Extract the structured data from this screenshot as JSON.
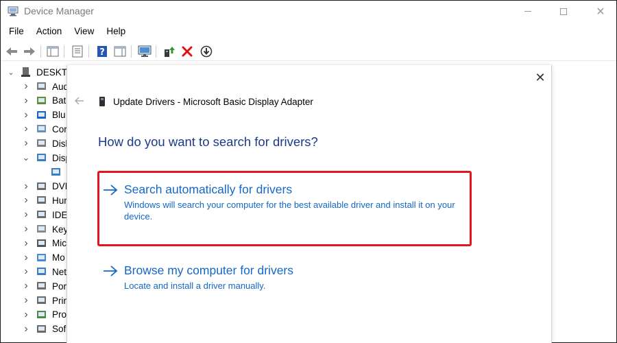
{
  "window": {
    "title": "Device Manager"
  },
  "menubar": [
    "File",
    "Action",
    "View",
    "Help"
  ],
  "tree": {
    "root_label": "DESKTO",
    "items": [
      {
        "label": "Aud",
        "expanded": false
      },
      {
        "label": "Bat",
        "expanded": false
      },
      {
        "label": "Blu",
        "expanded": false
      },
      {
        "label": "Cor",
        "expanded": false
      },
      {
        "label": "Disl",
        "expanded": false
      },
      {
        "label": "Disp",
        "expanded": true
      },
      {
        "label": "",
        "child": true
      },
      {
        "label": "DVD",
        "expanded": false
      },
      {
        "label": "Hur",
        "expanded": false
      },
      {
        "label": "IDE",
        "expanded": false
      },
      {
        "label": "Key",
        "expanded": false
      },
      {
        "label": "Mic",
        "expanded": false
      },
      {
        "label": "Mo",
        "expanded": false
      },
      {
        "label": "Net",
        "expanded": false
      },
      {
        "label": "Por",
        "expanded": false
      },
      {
        "label": "Prir",
        "expanded": false
      },
      {
        "label": "Pro",
        "expanded": false
      },
      {
        "label": "Sof",
        "expanded": false
      }
    ]
  },
  "dialog": {
    "title": "Update Drivers - Microsoft Basic Display Adapter",
    "heading": "How do you want to search for drivers?",
    "options": [
      {
        "title": "Search automatically for drivers",
        "description": "Windows will search your computer for the best available driver and install it on your device.",
        "highlighted": true
      },
      {
        "title": "Browse my computer for drivers",
        "description": "Locate and install a driver manually.",
        "highlighted": false
      }
    ]
  },
  "colors": {
    "link_blue": "#1467c4",
    "heading_blue": "#1c3a8c",
    "highlight_red": "#e5161b"
  }
}
